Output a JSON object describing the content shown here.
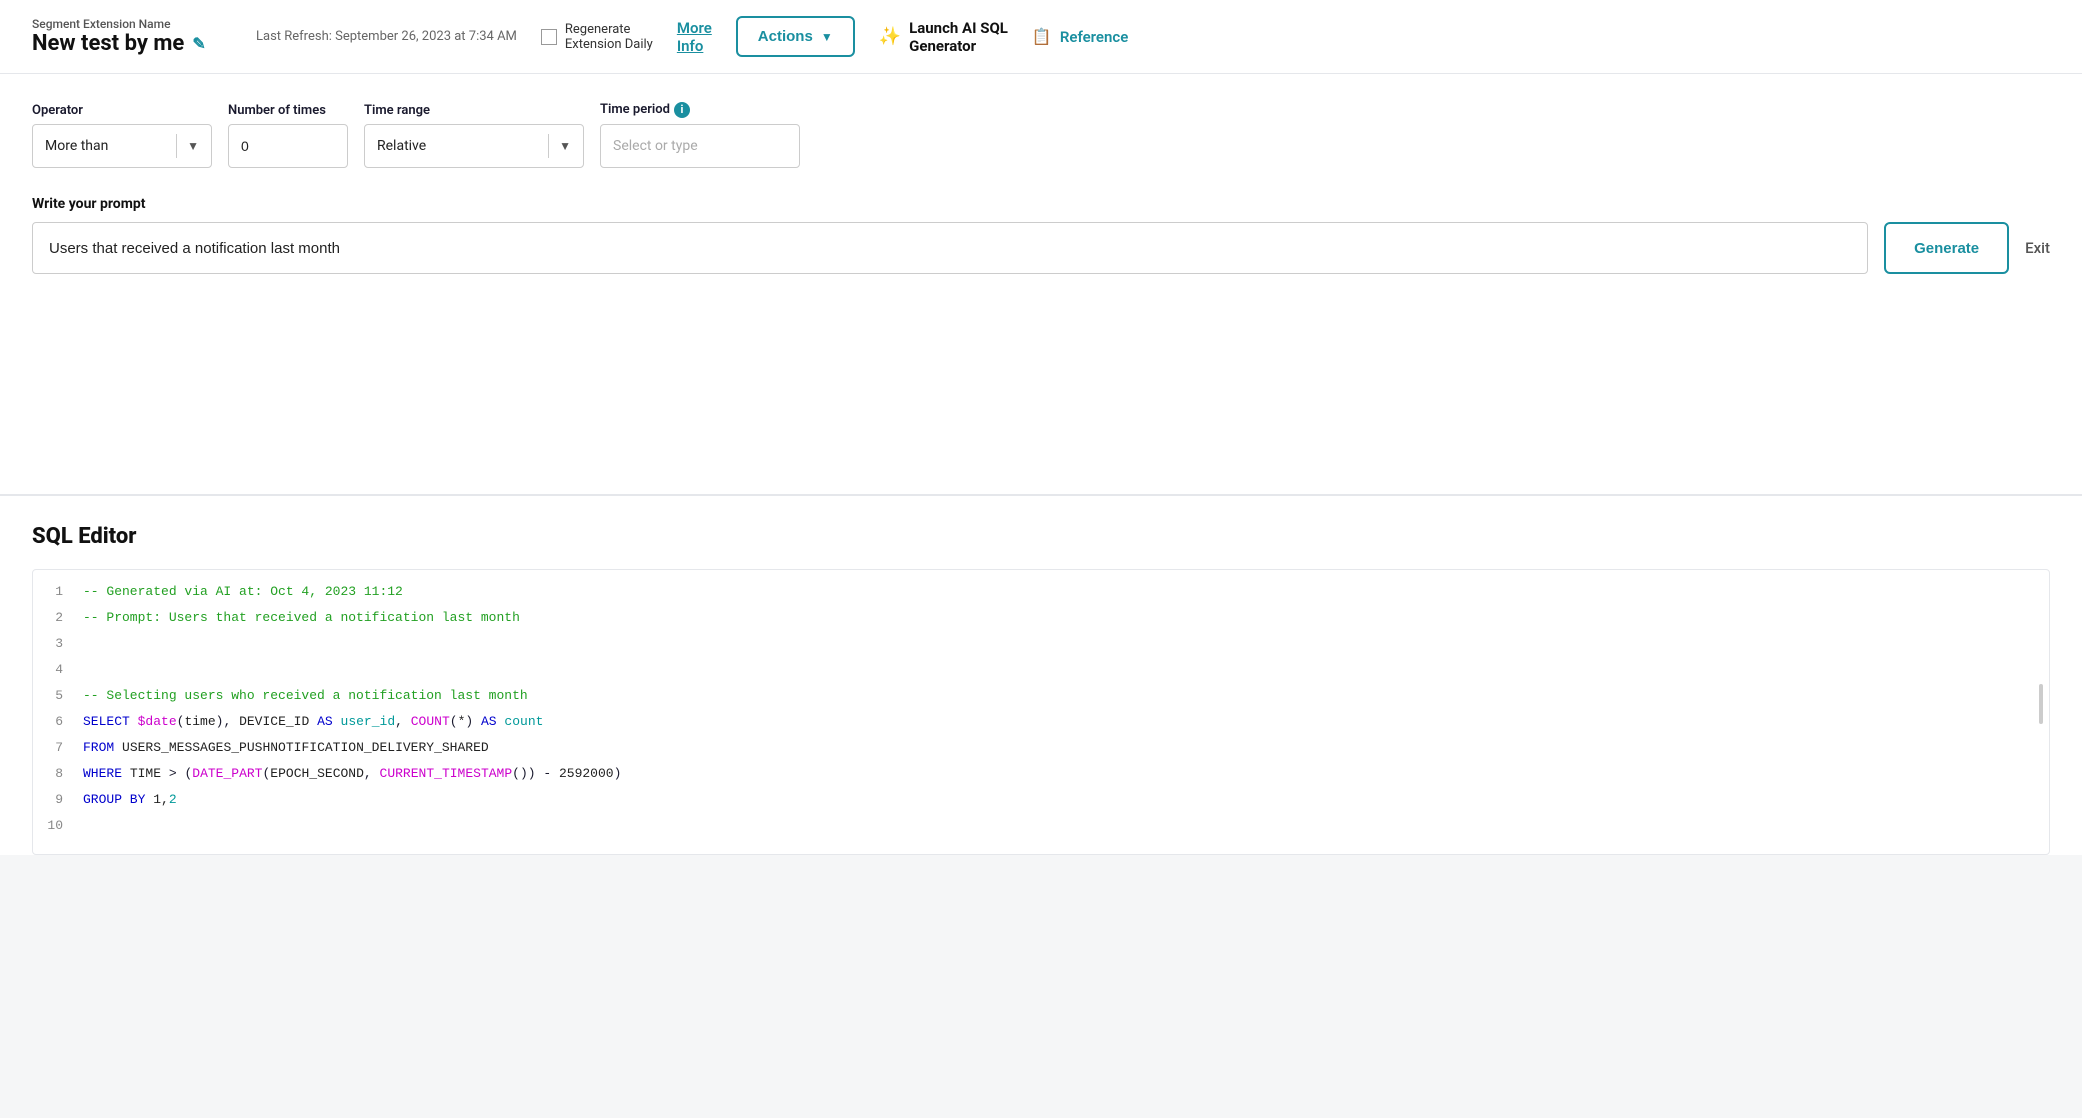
{
  "header": {
    "title_label": "Segment Extension Name",
    "title_name": "New test by me",
    "refresh_text": "Last Refresh: September 26, 2023 at 7:34 AM",
    "regen_label": "Regenerate\nExtension Daily",
    "more_info_label": "More\nInfo",
    "actions_label": "Actions",
    "ai_btn_label": "Launch AI SQL\nGenerator",
    "reference_label": "Reference"
  },
  "filter": {
    "operator_label": "Operator",
    "operator_value": "More than",
    "number_label": "Number of times",
    "number_value": "0",
    "time_range_label": "Time range",
    "time_range_value": "Relative",
    "time_period_label": "Time period",
    "time_period_placeholder": "Select or type"
  },
  "prompt": {
    "section_label": "Write your prompt",
    "input_value": "Users that received a notification last month",
    "generate_label": "Generate",
    "exit_label": "Exit"
  },
  "sql_editor": {
    "title": "SQL Editor",
    "lines": [
      {
        "num": "1",
        "code": "-- Generated via AI at: Oct 4, 2023 11:12",
        "type": "comment"
      },
      {
        "num": "2",
        "code": "-- Prompt: Users that received a notification last month",
        "type": "comment"
      },
      {
        "num": "3",
        "code": "",
        "type": "plain"
      },
      {
        "num": "4",
        "code": "",
        "type": "plain"
      },
      {
        "num": "5",
        "code": "-- Selecting users who received a notification last month",
        "type": "comment"
      },
      {
        "num": "6",
        "code": "SELECT $date(time), DEVICE_ID AS user_id, COUNT(*) AS count",
        "type": "mixed"
      },
      {
        "num": "7",
        "code": "FROM USERS_MESSAGES_PUSHNOTIFICATION_DELIVERY_SHARED",
        "type": "keyword_from"
      },
      {
        "num": "8",
        "code": "WHERE TIME > (DATE_PART(EPOCH_SECOND, CURRENT_TIMESTAMP()) - 2592000)",
        "type": "where"
      },
      {
        "num": "9",
        "code": "GROUP BY 1,2",
        "type": "group"
      },
      {
        "num": "10",
        "code": "",
        "type": "plain"
      }
    ]
  }
}
